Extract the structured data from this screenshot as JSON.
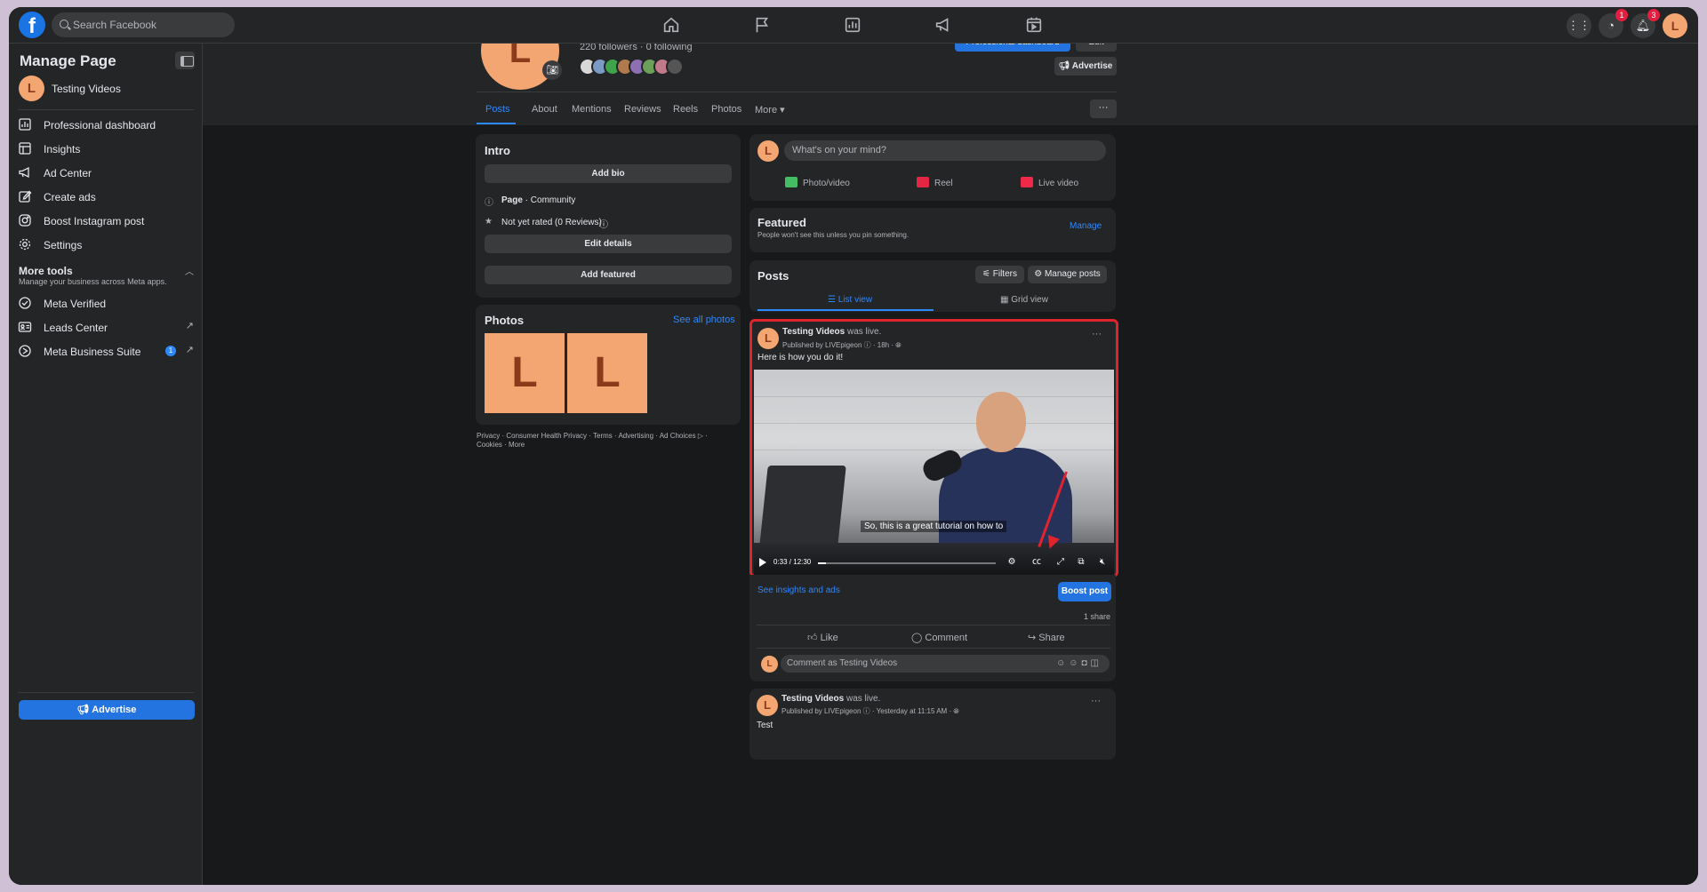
{
  "topbar": {
    "search_placeholder": "Search Facebook",
    "messenger_badge": "1",
    "notifications_badge": "3",
    "user_initial": "L"
  },
  "sidebar": {
    "title": "Manage Page",
    "page_name": "Testing Videos",
    "page_initial": "L",
    "items": [
      {
        "label": "Professional dashboard"
      },
      {
        "label": "Insights"
      },
      {
        "label": "Ad Center"
      },
      {
        "label": "Create ads"
      },
      {
        "label": "Boost Instagram post"
      },
      {
        "label": "Settings"
      }
    ],
    "more_tools": {
      "title": "More tools",
      "subtitle": "Manage your business across Meta apps."
    },
    "tools": [
      {
        "label": "Meta Verified"
      },
      {
        "label": "Leads Center"
      },
      {
        "label": "Meta Business Suite",
        "count": "1"
      }
    ],
    "advertise_label": "Advertise"
  },
  "profile": {
    "initial": "L",
    "followers_text": "220 followers · 0 following",
    "professional_dashboard_label": "Professional dashboard",
    "edit_label": "Edit",
    "advertise_label": "Advertise",
    "tabs": [
      {
        "label": "Posts"
      },
      {
        "label": "About"
      },
      {
        "label": "Mentions"
      },
      {
        "label": "Reviews"
      },
      {
        "label": "Reels"
      },
      {
        "label": "Photos"
      },
      {
        "label": "More ▾"
      }
    ],
    "more_dots": "···"
  },
  "intro": {
    "title": "Intro",
    "add_bio": "Add bio",
    "page_label": "Page",
    "page_category": " · Community",
    "rating": "Not yet rated (0 Reviews)",
    "edit_details": "Edit details",
    "add_featured": "Add featured"
  },
  "photos": {
    "title": "Photos",
    "see_all": "See all photos",
    "tile_letter": "L"
  },
  "footer": {
    "links": "Privacy · Consumer Health Privacy · Terms · Advertising · Ad Choices ▷ · Cookies · More"
  },
  "composer": {
    "initial": "L",
    "placeholder": "What's on your mind?",
    "actions": [
      {
        "label": "Photo/video",
        "color": "#45bd62"
      },
      {
        "label": "Reel",
        "color": "#e42645"
      },
      {
        "label": "Live video",
        "color": "#f02849"
      }
    ]
  },
  "featured": {
    "title": "Featured",
    "subtitle": "People won't see this unless you pin something.",
    "manage": "Manage"
  },
  "posts_header": {
    "title": "Posts",
    "filters": "Filters",
    "manage_posts": "Manage posts",
    "list_view": "List view",
    "grid_view": "Grid view"
  },
  "post1": {
    "initial": "L",
    "author": "Testing Videos",
    "action": " was live.",
    "published_by": "Published by LIVEpigeon",
    "time": "18h",
    "text": "Here is how you do it!",
    "video_caption": "So, this is a great tutorial on how to",
    "video_time": "0:33 / 12:30",
    "video_progress": 0.045,
    "more": "···"
  },
  "post1_footer": {
    "insights": "See insights and ads",
    "boost": "Boost post",
    "shares": "1 share",
    "like": "Like",
    "comment": "Comment",
    "share": "Share",
    "comment_placeholder": "Comment as Testing Videos"
  },
  "post2": {
    "initial": "L",
    "author": "Testing Videos",
    "action": " was live.",
    "published_by": "Published by LIVEpigeon",
    "time": "Yesterday at 11:15 AM",
    "text": "Test",
    "more": "···"
  }
}
